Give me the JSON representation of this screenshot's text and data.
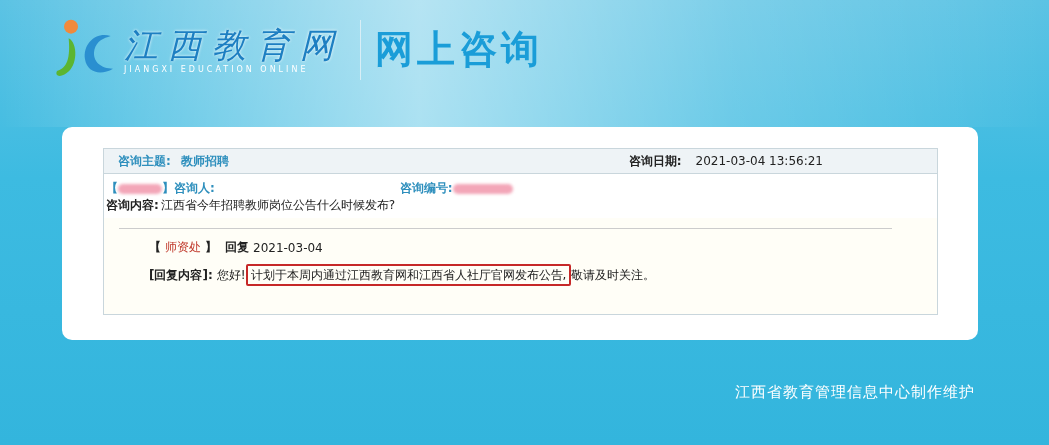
{
  "header": {
    "logo_text": "江西教育网",
    "logo_subtext": "JIANGXI EDUCATION ONLINE",
    "title": "网上咨询"
  },
  "consultation": {
    "topic_label": "咨询主题:",
    "topic": "教师招聘",
    "date_label": "咨询日期:",
    "date": "2021-03-04 13:56:21",
    "asker_open": "【",
    "asker_close": "】咨询人:",
    "number_label": "咨询编号:",
    "content_label": "咨询内容:",
    "content": "江西省今年招聘教师岗位公告什么时候发布?"
  },
  "reply": {
    "open": "【",
    "department": "师资处",
    "close": "】",
    "reply_label": "回复",
    "date": "2021-03-04",
    "content_label": "[回复内容]:",
    "before": "您好!",
    "highlight": "计划于本周内通过江西教育网和江西省人社厅官网发布公告,",
    "after": "敬请及时关注。"
  },
  "footer": "江西省教育管理信息中心制作维护"
}
